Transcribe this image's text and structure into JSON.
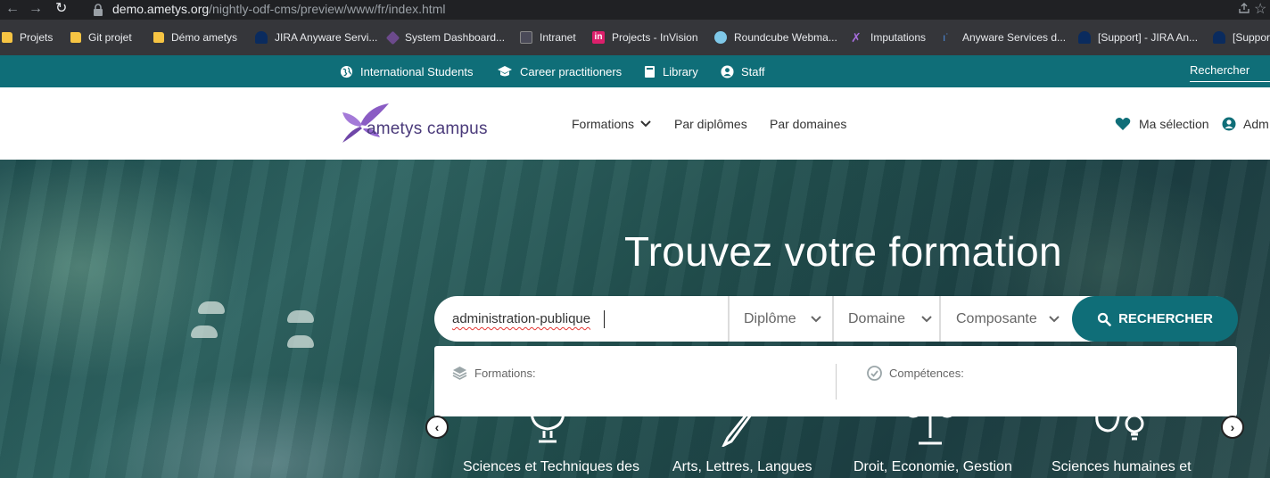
{
  "browser": {
    "url_host": "demo.ametys.org",
    "url_path": "/nightly-odf-cms/preview/www/fr/index.html"
  },
  "bookmarks": [
    {
      "label": "Projets",
      "icon": "folder-icon"
    },
    {
      "label": "Git projet",
      "icon": "folder-icon"
    },
    {
      "label": "Démo ametys",
      "icon": "folder-icon"
    },
    {
      "label": "JIRA Anyware Servi...",
      "icon": "jira-icon"
    },
    {
      "label": "System Dashboard...",
      "icon": "dashboard-icon"
    },
    {
      "label": "Intranet",
      "icon": "intranet-icon"
    },
    {
      "label": "Projects - InVision",
      "icon": "invision-icon"
    },
    {
      "label": "Roundcube Webma...",
      "icon": "roundcube-icon"
    },
    {
      "label": "Imputations",
      "icon": "imputations-icon"
    },
    {
      "label": "Anyware Services d...",
      "icon": "anyware-icon"
    },
    {
      "label": "[Support] - JIRA An...",
      "icon": "jira-icon"
    },
    {
      "label": "[Suppor",
      "icon": "jira-icon"
    }
  ],
  "topbar": {
    "links": [
      "International Students",
      "Career practitioners",
      "Library",
      "Staff"
    ],
    "search_label": "Rechercher",
    "color": "#0f6e78"
  },
  "header": {
    "logo_text": "ametys campus",
    "menu": [
      "Formations",
      "Par diplômes",
      "Par domaines"
    ],
    "selection": "Ma sélection",
    "account": "Adm"
  },
  "hero": {
    "title": "Trouvez votre formation",
    "search_value": "administration-publique",
    "selects": [
      "Diplôme",
      "Domaine",
      "Composante"
    ],
    "search_button": "RECHERCHER",
    "suggest_formations": "Formations:",
    "suggest_competences": "Compétences:",
    "categories": [
      "Sciences et Techniques des",
      "Arts, Lettres, Langues",
      "Droit, Economie, Gestion",
      "Sciences humaines et"
    ],
    "prev_arrow": "‹",
    "next_arrow": "›"
  }
}
